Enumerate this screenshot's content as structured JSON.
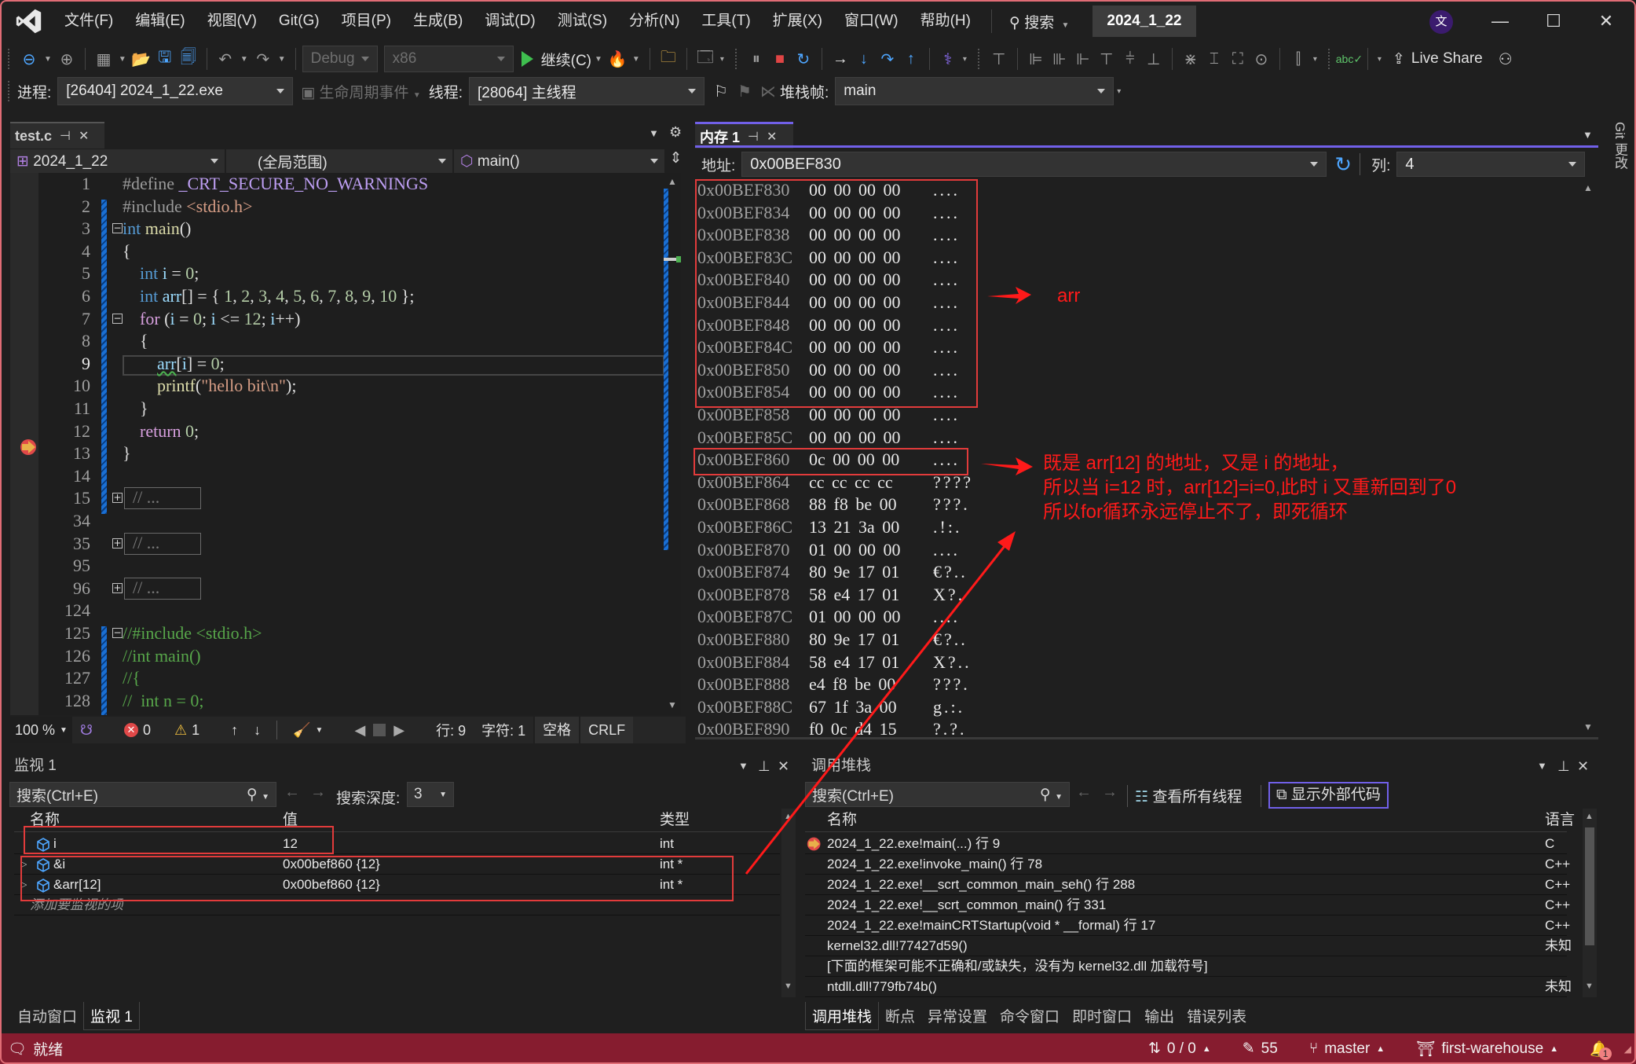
{
  "menu": {
    "items": [
      "文件(F)",
      "编辑(E)",
      "视图(V)",
      "Git(G)",
      "项目(P)",
      "生成(B)",
      "调试(D)",
      "测试(S)",
      "分析(N)",
      "工具(T)",
      "扩展(X)",
      "窗口(W)",
      "帮助(H)"
    ],
    "search_label": "搜索",
    "solution_title": "2024_1_22",
    "avatar_letter": "文"
  },
  "toolbar": {
    "config": "Debug",
    "platform": "x86",
    "continue_label": "继续(C)",
    "live_share_label": "Live Share"
  },
  "debug_toolbar": {
    "process_label": "进程:",
    "process_value": "[26404] 2024_1_22.exe",
    "lifecycle_label": "生命周期事件",
    "thread_label": "线程:",
    "thread_value": "[28064] 主线程",
    "stack_frame_label": "堆栈帧:",
    "stack_frame_value": "main"
  },
  "editor": {
    "tab_name": "test.c",
    "nav_project": "2024_1_22",
    "nav_scope": "(全局范围)",
    "nav_member": "main()",
    "current_line": 9,
    "lines": [
      {
        "n": "1",
        "html": "<span class=\"pp\">#define</span> <span class=\"mac\">_CRT_SECURE_NO_WARNINGS</span>"
      },
      {
        "n": "2",
        "html": "<span class=\"pp\">#include</span> <span class=\"str\">&lt;stdio.h&gt;</span>"
      },
      {
        "n": "3",
        "html": "<span class=\"kw\">int</span> <span class=\"fn\">main</span>()"
      },
      {
        "n": "4",
        "html": "{"
      },
      {
        "n": "5",
        "html": "    <span class=\"kw\">int</span> <span class=\"var\">i</span> = <span class=\"num\">0</span>;"
      },
      {
        "n": "6",
        "html": "    <span class=\"kw\">int</span> <span class=\"var\">arr</span>[] = { <span class=\"num\">1</span>, <span class=\"num\">2</span>, <span class=\"num\">3</span>, <span class=\"num\">4</span>, <span class=\"num\">5</span>, <span class=\"num\">6</span>, <span class=\"num\">7</span>, <span class=\"num\">8</span>, <span class=\"num\">9</span>, <span class=\"num\">10</span> };"
      },
      {
        "n": "7",
        "html": "    <span class=\"ctl\">for</span> (<span class=\"var\">i</span> = <span class=\"num\">0</span>; <span class=\"var\">i</span> &lt;= <span class=\"num\">12</span>; <span class=\"var\">i</span>++)"
      },
      {
        "n": "8",
        "html": "    {"
      },
      {
        "n": "9",
        "html": "        <span class=\"var\" style=\"text-decoration: underline wavy #4cb050;\">arr</span>[<span class=\"var\">i</span>] = <span class=\"num\">0</span>;"
      },
      {
        "n": "10",
        "html": "        <span class=\"fn\">printf</span>(<span class=\"str\">\"hello bit\\n\"</span>);"
      },
      {
        "n": "11",
        "html": "    }"
      },
      {
        "n": "12",
        "html": "    <span class=\"ctl\">return</span> <span class=\"num\">0</span>;"
      },
      {
        "n": "13",
        "html": "}"
      },
      {
        "n": "14",
        "html": ""
      },
      {
        "n": "15",
        "html": "",
        "collapsed": "// ..."
      },
      {
        "n": "34",
        "html": ""
      },
      {
        "n": "35",
        "html": "",
        "collapsed": "// ..."
      },
      {
        "n": "95",
        "html": ""
      },
      {
        "n": "96",
        "html": "",
        "collapsed": "// ..."
      },
      {
        "n": "124",
        "html": ""
      },
      {
        "n": "125",
        "html": "<span class=\"cm\">//#include &lt;stdio.h&gt;</span>"
      },
      {
        "n": "126",
        "html": "<span class=\"cm\">//int main()</span>"
      },
      {
        "n": "127",
        "html": "<span class=\"cm\">//{</span>"
      },
      {
        "n": "128",
        "html": "<span class=\"cm\">//  int n = 0;</span>"
      }
    ],
    "status": {
      "zoom": "100 %",
      "errors": "0",
      "warnings": "1",
      "line": "行: 9",
      "char": "字符: 1",
      "whitespace": "空格",
      "eol": "CRLF"
    }
  },
  "memory": {
    "tab_name": "内存 1",
    "address_label": "地址:",
    "address_value": "0x00BEF830",
    "columns_label": "列:",
    "columns_value": "4",
    "rows": [
      {
        "addr": "0x00BEF830",
        "bytes": "00 00 00 00",
        "ascii": "...."
      },
      {
        "addr": "0x00BEF834",
        "bytes": "00 00 00 00",
        "ascii": "...."
      },
      {
        "addr": "0x00BEF838",
        "bytes": "00 00 00 00",
        "ascii": "...."
      },
      {
        "addr": "0x00BEF83C",
        "bytes": "00 00 00 00",
        "ascii": "...."
      },
      {
        "addr": "0x00BEF840",
        "bytes": "00 00 00 00",
        "ascii": "...."
      },
      {
        "addr": "0x00BEF844",
        "bytes": "00 00 00 00",
        "ascii": "...."
      },
      {
        "addr": "0x00BEF848",
        "bytes": "00 00 00 00",
        "ascii": "...."
      },
      {
        "addr": "0x00BEF84C",
        "bytes": "00 00 00 00",
        "ascii": "...."
      },
      {
        "addr": "0x00BEF850",
        "bytes": "00 00 00 00",
        "ascii": "...."
      },
      {
        "addr": "0x00BEF854",
        "bytes": "00 00 00 00",
        "ascii": "...."
      },
      {
        "addr": "0x00BEF858",
        "bytes": "00 00 00 00",
        "ascii": "...."
      },
      {
        "addr": "0x00BEF85C",
        "bytes": "00 00 00 00",
        "ascii": "...."
      },
      {
        "addr": "0x00BEF860",
        "bytes": "0c 00 00 00",
        "ascii": "...."
      },
      {
        "addr": "0x00BEF864",
        "bytes": "cc cc cc cc",
        "ascii": "????"
      },
      {
        "addr": "0x00BEF868",
        "bytes": "88 f8 be 00",
        "ascii": "???."
      },
      {
        "addr": "0x00BEF86C",
        "bytes": "13 21 3a 00",
        "ascii": ".!:."
      },
      {
        "addr": "0x00BEF870",
        "bytes": "01 00 00 00",
        "ascii": "...."
      },
      {
        "addr": "0x00BEF874",
        "bytes": "80 9e 17 01",
        "ascii": "€?.."
      },
      {
        "addr": "0x00BEF878",
        "bytes": "58 e4 17 01",
        "ascii": "X?."
      },
      {
        "addr": "0x00BEF87C",
        "bytes": "01 00 00 00",
        "ascii": "...."
      },
      {
        "addr": "0x00BEF880",
        "bytes": "80 9e 17 01",
        "ascii": "€?.."
      },
      {
        "addr": "0x00BEF884",
        "bytes": "58 e4 17 01",
        "ascii": "X?.."
      },
      {
        "addr": "0x00BEF888",
        "bytes": "e4 f8 be 00",
        "ascii": "???."
      },
      {
        "addr": "0x00BEF88C",
        "bytes": "67 1f 3a 00",
        "ascii": "g.:."
      },
      {
        "addr": "0x00BEF890",
        "bytes": "f0 0c d4 15",
        "ascii": "?.?."
      }
    ]
  },
  "annotations": {
    "arr_label": "arr",
    "note_lines": [
      "既是 arr[12] 的地址，又是 i 的地址，",
      "所以当 i=12 时，arr[12]=i=0,此时 i 又重新回到了0",
      "所以for循环永远停止不了，即死循环"
    ],
    "color": "#ff1a1a"
  },
  "git_side_label": "Git 更改",
  "watch": {
    "title": "监视 1",
    "search_placeholder": "搜索(Ctrl+E)",
    "depth_label": "搜索深度:",
    "depth_value": "3",
    "columns": [
      "名称",
      "值",
      "类型"
    ],
    "rows": [
      {
        "name": "i",
        "value": "12",
        "type": "int",
        "expandable": false
      },
      {
        "name": "&i",
        "value": "0x00bef860 {12}",
        "type": "int *",
        "expandable": true
      },
      {
        "name": "&arr[12]",
        "value": "0x00bef860 {12}",
        "type": "int *",
        "expandable": true
      }
    ],
    "add_item_placeholder": "添加要监视的项",
    "bottom_tabs": [
      "自动窗口",
      "监视 1"
    ]
  },
  "callstack": {
    "title": "调用堆栈",
    "search_placeholder": "搜索(Ctrl+E)",
    "view_threads_label": "查看所有线程",
    "show_external_label": "显示外部代码",
    "columns": [
      "名称",
      "语言"
    ],
    "rows": [
      {
        "name": "2024_1_22.exe!main(...) 行 9",
        "lang": "C",
        "current": true
      },
      {
        "name": "2024_1_22.exe!invoke_main() 行 78",
        "lang": "C++"
      },
      {
        "name": "2024_1_22.exe!__scrt_common_main_seh() 行 288",
        "lang": "C++"
      },
      {
        "name": "2024_1_22.exe!__scrt_common_main() 行 331",
        "lang": "C++"
      },
      {
        "name": "2024_1_22.exe!mainCRTStartup(void * __formal) 行 17",
        "lang": "C++"
      },
      {
        "name": "kernel32.dll!77427d59()",
        "lang": "未知"
      },
      {
        "name": "[下面的框架可能不正确和/或缺失，没有为 kernel32.dll 加载符号]",
        "lang": ""
      },
      {
        "name": "ntdll.dll!779fb74b()",
        "lang": "未知"
      }
    ],
    "bottom_tabs": [
      "调用堆栈",
      "断点",
      "异常设置",
      "命令窗口",
      "即时窗口",
      "输出",
      "错误列表"
    ]
  },
  "statusbar": {
    "ready": "就绪",
    "sync": "0 / 0",
    "changes": "55",
    "branch": "master",
    "repo": "first-warehouse",
    "notifications": "1"
  }
}
